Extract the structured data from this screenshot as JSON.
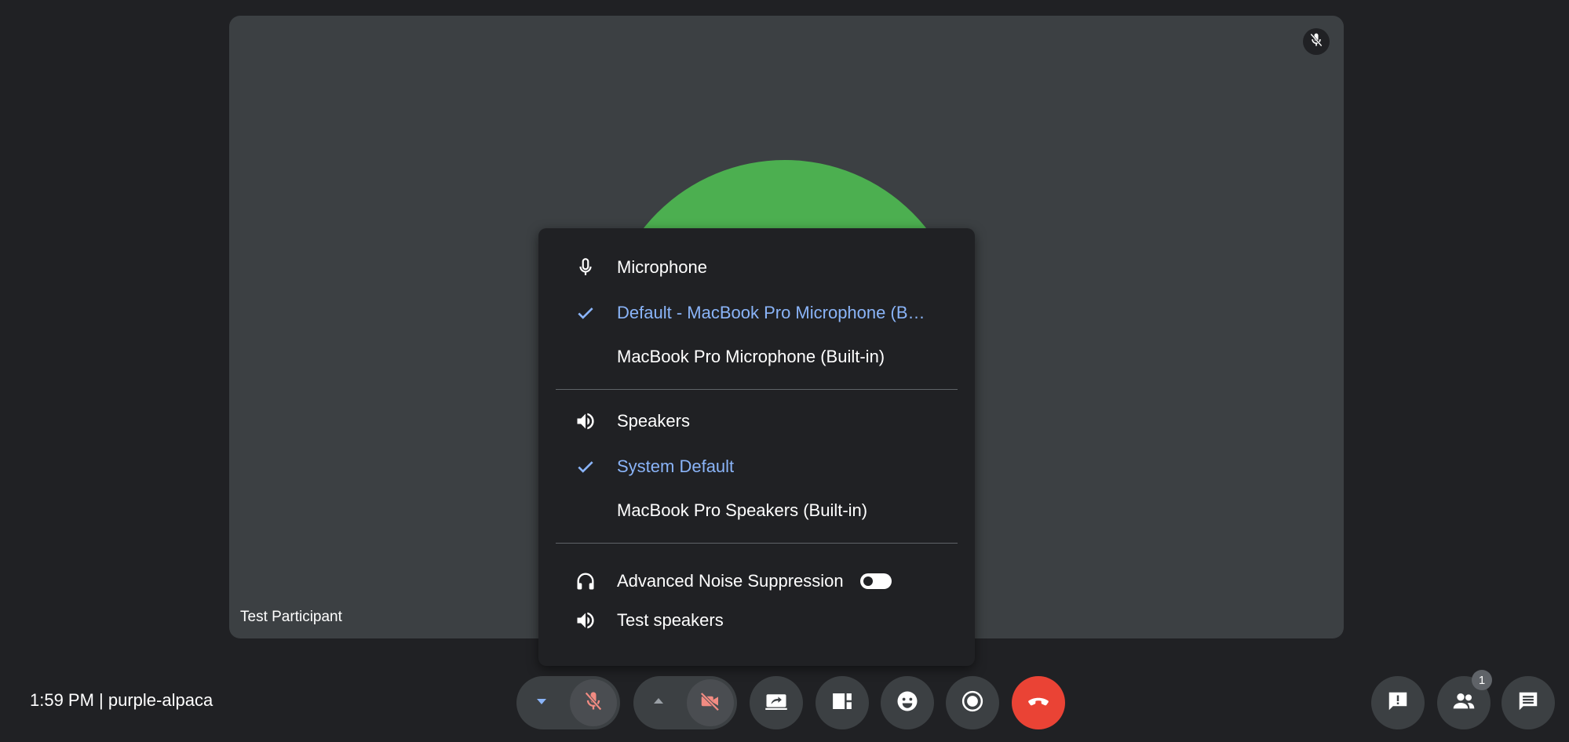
{
  "tile": {
    "participant_name": "Test Participant",
    "avatar_color": "#4caf50",
    "muted_icon": "mic-off-icon"
  },
  "menu": {
    "microphone": {
      "header": "Microphone",
      "header_icon": "microphone-icon",
      "options": [
        {
          "label": "Default - MacBook Pro Microphone (B…",
          "selected": true
        },
        {
          "label": "MacBook Pro Microphone (Built-in)",
          "selected": false
        }
      ]
    },
    "speakers": {
      "header": "Speakers",
      "header_icon": "speaker-icon",
      "options": [
        {
          "label": "System Default",
          "selected": true
        },
        {
          "label": "MacBook Pro Speakers (Built-in)",
          "selected": false
        }
      ]
    },
    "noise_suppression": {
      "label": "Advanced Noise Suppression",
      "icon": "headphones-icon",
      "enabled": false
    },
    "test_speakers": {
      "label": "Test speakers",
      "icon": "speaker-icon"
    },
    "selected_color": "#8ab4f8"
  },
  "bottom_bar": {
    "meeting_info": "1:59 PM | purple-alpaca",
    "controls": [
      {
        "name": "audio-settings-caret",
        "icon": "caret-down-icon"
      },
      {
        "name": "mic-toggle",
        "icon": "mic-off-icon",
        "state": "off"
      },
      {
        "name": "video-settings-caret",
        "icon": "caret-up-icon"
      },
      {
        "name": "camera-toggle",
        "icon": "camera-off-icon",
        "state": "off"
      },
      {
        "name": "present-screen",
        "icon": "present-screen-icon"
      },
      {
        "name": "layout",
        "icon": "layout-icon"
      },
      {
        "name": "reactions",
        "icon": "emoji-icon"
      },
      {
        "name": "record",
        "icon": "record-icon"
      },
      {
        "name": "end-call",
        "icon": "end-call-icon"
      }
    ],
    "right_controls": [
      {
        "name": "feedback",
        "icon": "feedback-icon"
      },
      {
        "name": "participants",
        "icon": "people-icon",
        "count": "1"
      },
      {
        "name": "chat",
        "icon": "chat-icon"
      }
    ],
    "end_call_color": "#ea4335",
    "off_icon_color": "#f28b82"
  }
}
